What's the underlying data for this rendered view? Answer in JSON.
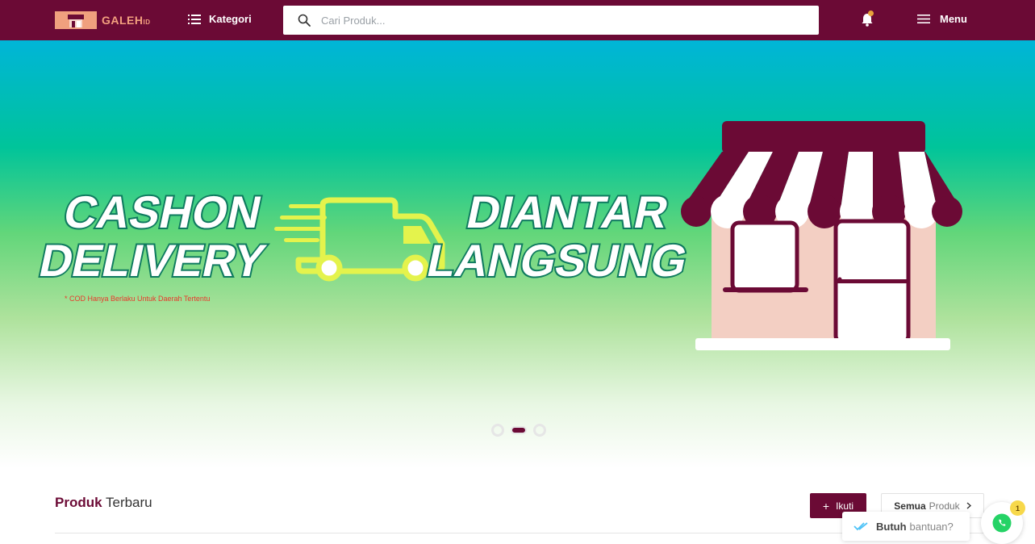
{
  "header": {
    "logo_text": "GALEH",
    "logo_suffix": "ID",
    "kategori_label": "Kategori",
    "search_placeholder": "Cari Produk...",
    "menu_label": "Menu"
  },
  "banner": {
    "headline_left_1": "CASHON",
    "headline_left_2": "DELIVERY",
    "disclaimer": "* COD Hanya Berlaku Untuk Daerah Tertentu",
    "headline_right_1": "DIANTAR",
    "headline_right_2": "LANGSUNG",
    "slide_count": 3,
    "active_slide": 2
  },
  "section": {
    "title_bold": "Produk",
    "title_rest": "Terbaru",
    "follow_label": "Ikuti",
    "all_bold": "Semua",
    "all_rest": "Produk"
  },
  "help": {
    "label_bold": "Butuh",
    "label_rest": "bantuan?",
    "badge_count": "1"
  },
  "colors": {
    "brand": "#6b0a35",
    "logo": "#f0a07e",
    "headline_fill": "#ffffff",
    "headline_stroke": "#0e7a5f",
    "truck": "#e4f34c",
    "whatsapp": "#25d366"
  }
}
